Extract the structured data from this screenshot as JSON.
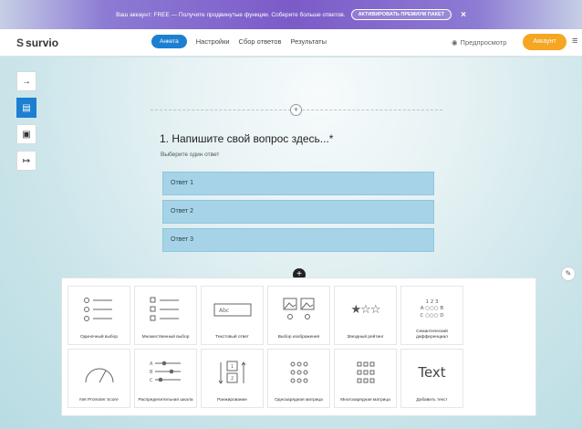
{
  "promo": {
    "text": "Ваш аккаунт: FREE — Получите продвинутые функции. Соберите больше ответов.",
    "upgrade_label": "АКТИВИРОВАТЬ ПРЕМИУМ ПАКЕТ",
    "close_icon": "×"
  },
  "header": {
    "logo": "survio",
    "logo_mark": "S",
    "nav": [
      "Анкета",
      "Настройки",
      "Сбор ответов",
      "Результаты"
    ],
    "preview": "Предпросмотр",
    "preview_icon": "eye-icon",
    "account_label": "Аккаунт",
    "menu_icon": "≡"
  },
  "tools": [
    {
      "name": "login-icon",
      "glyph": "→"
    },
    {
      "name": "document-icon",
      "glyph": "▤"
    },
    {
      "name": "page-icon",
      "glyph": "▣"
    },
    {
      "name": "exit-icon",
      "glyph": "↦"
    }
  ],
  "question": {
    "divider_plus": "+",
    "title": "1. Напишите свой вопрос здесь...*",
    "subtitle": "Выберите один ответ",
    "answers": [
      "Ответ 1",
      "Ответ 2",
      "Ответ 3"
    ]
  },
  "add_button": "+",
  "wrench_icon": "🔧",
  "question_types": [
    {
      "label": "Одиночный выбор",
      "icon": "single-choice-icon"
    },
    {
      "label": "Множественный выбор",
      "icon": "multiple-choice-icon"
    },
    {
      "label": "Текстовый ответ",
      "icon": "text-answer-icon"
    },
    {
      "label": "Выбор изображения",
      "icon": "image-choice-icon"
    },
    {
      "label": "Звездный рейтинг",
      "icon": "star-rating-icon"
    },
    {
      "label": "Семантический дифференциал",
      "icon": "semantic-icon"
    },
    {
      "label": "Net Promoter Score",
      "icon": "nps-gauge-icon"
    },
    {
      "label": "Распределительная шкала",
      "icon": "slider-scale-icon"
    },
    {
      "label": "Ранжирование",
      "icon": "ranking-icon"
    },
    {
      "label": "Однозарядная матрица",
      "icon": "single-matrix-icon"
    },
    {
      "label": "Многозарядная матрица",
      "icon": "multi-matrix-icon"
    },
    {
      "label": "Добавить текст",
      "icon": "add-text-icon",
      "icon_text": "Text"
    }
  ],
  "icon_texts": {
    "text_field_sample": "Abc",
    "semantic": "1 2 3\nA ○○○ B\nC ○○○ D",
    "semantic_row1": "1 2 3",
    "semantic_row2": "A ○○○ B",
    "semantic_row3": "C ○○○ D",
    "ranking_1": "1",
    "ranking_2": "2",
    "slider_a": "A",
    "slider_b": "B",
    "slider_c": "C"
  },
  "colors": {
    "accent_blue": "#1d7fd1",
    "account_orange": "#f5a623",
    "answer_bg": "#a6d3e7",
    "promo_purple": "#7c5bc8"
  }
}
